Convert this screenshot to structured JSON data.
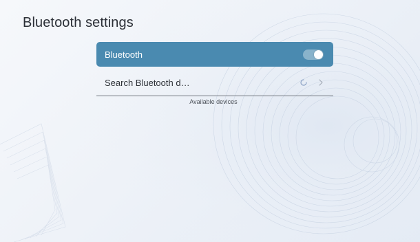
{
  "page": {
    "title": "Bluetooth settings"
  },
  "bluetooth_row": {
    "label": "Bluetooth",
    "toggle_state": "on"
  },
  "search_row": {
    "label": "Search Bluetooth d…",
    "status": "searching"
  },
  "available_section": {
    "caption": "Available devices"
  },
  "icons": {
    "toggle": "toggle-switch-icon",
    "spinner": "loading-spinner-icon",
    "chevron": "chevron-right-icon"
  },
  "colors": {
    "accent": "#4a8ab0",
    "title_text": "#2b2f36",
    "body_text": "#2e3238"
  }
}
